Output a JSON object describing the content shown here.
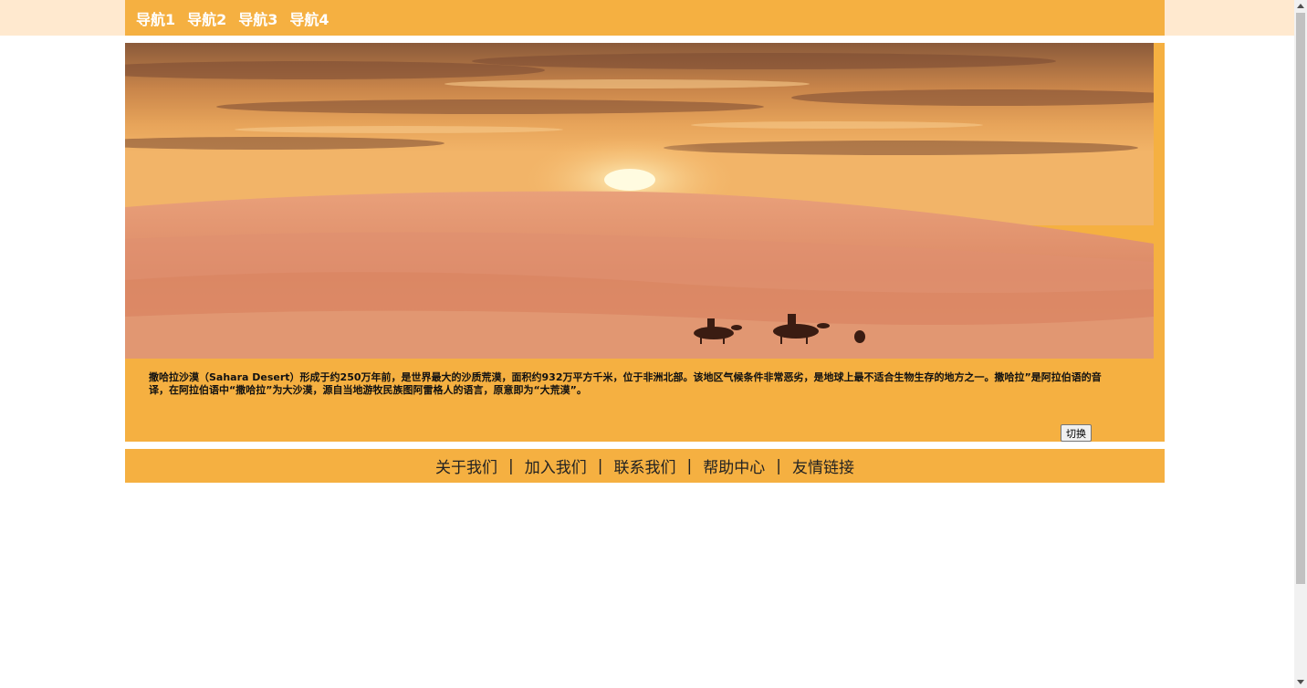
{
  "nav": {
    "items": [
      "导航1",
      "导航2",
      "导航3",
      "导航4"
    ]
  },
  "content": {
    "description": "撒哈拉沙漠（Sahara Desert）形成于约250万年前，是世界最大的沙质荒漠，面积约932万平方千米，位于非洲北部。该地区气候条件非常恶劣，是地球上最不适合生物生存的地方之一。撒哈拉”是阿拉伯语的音译，在阿拉伯语中“撒哈拉”为大沙漠，源自当地游牧民族图阿雷格人的语言，原意即为“大荒漠”。",
    "switch_label": "切换"
  },
  "footer": {
    "links": [
      "关于我们",
      "加入我们",
      "联系我们",
      "帮助中心",
      "友情链接"
    ],
    "separator": "|"
  },
  "colors": {
    "accent": "#f5b041",
    "top_band": "#ffe9cf"
  }
}
